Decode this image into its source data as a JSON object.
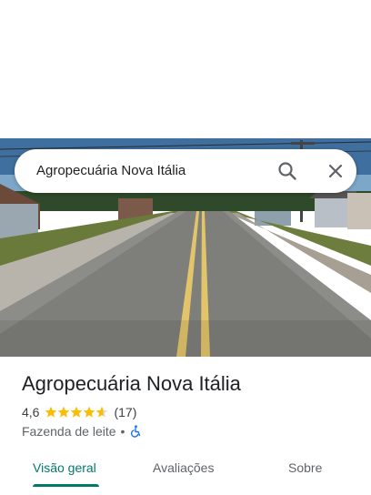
{
  "search": {
    "query": "Agropecuária Nova Itália"
  },
  "place": {
    "name": "Agropecuária Nova Itália",
    "rating_text": "4,6",
    "rating": 4.6,
    "stars_max": 5,
    "review_count_text": "(17)",
    "category": "Fazenda de leite",
    "separator": "•"
  },
  "tabs": [
    {
      "label": "Visão geral",
      "active": true
    },
    {
      "label": "Avaliações",
      "active": false
    },
    {
      "label": "Sobre",
      "active": false
    }
  ],
  "icons": {
    "search": "search-icon",
    "close": "close-icon",
    "star": "star-icon",
    "accessibility": "wheelchair-icon"
  },
  "colors": {
    "accent": "#00796b",
    "star": "#fbbc04",
    "accessibility": "#1a73e8"
  }
}
